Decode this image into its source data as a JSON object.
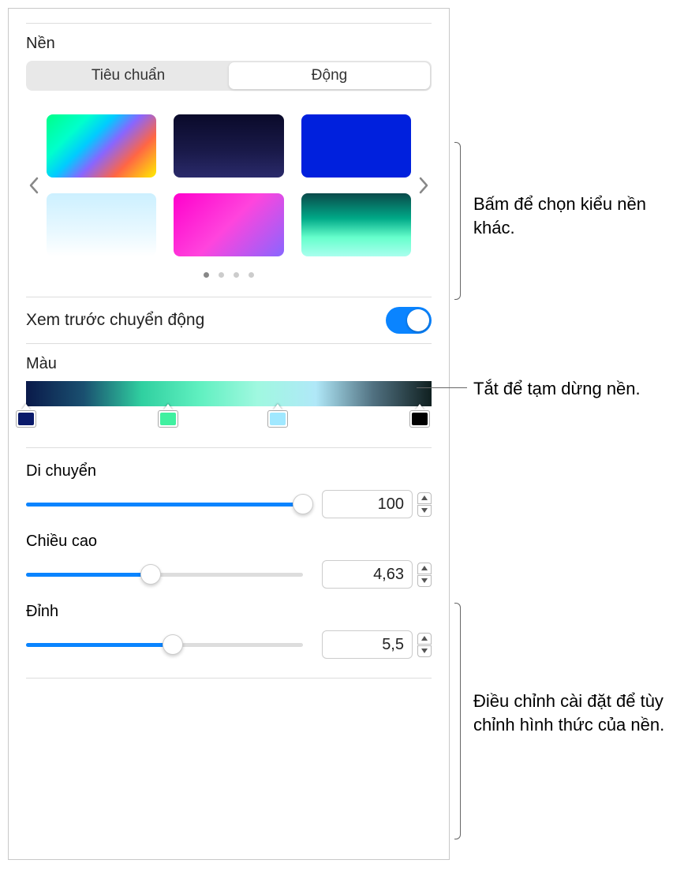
{
  "section_bg_title": "Nền",
  "segments": {
    "standard": "Tiêu chuẩn",
    "dynamic": "Động"
  },
  "thumbs": [
    {
      "name": "rainbow-gradient",
      "style": "background:linear-gradient(135deg,#00ff88 0%,#00ffcc 25%,#00ccff 40%,#8866ff 55%,#ff6644 75%,#ffee00 100%)"
    },
    {
      "name": "dark-clouds",
      "style": "background:linear-gradient(180deg,#0a0a2a 0%,#1a1a4a 60%,#2a2a6a 100%)"
    },
    {
      "name": "solid-blue",
      "style": "background:#0020dd"
    },
    {
      "name": "white-cloud-sky",
      "style": "background:linear-gradient(180deg,#ccf0ff 0%,#e8f8ff 60%,#ffffff 100%)"
    },
    {
      "name": "magenta-blue",
      "style": "background:linear-gradient(135deg,#ff00cc 0%,#ff44dd 50%,#8866ff 100%)"
    },
    {
      "name": "teal-clouds",
      "style": "background:linear-gradient(180deg,#0a4a4a 0%,#00aa88 40%,#66ffcc 70%,#aaffee 100%)"
    }
  ],
  "motion_preview_label": "Xem trước chuyển động",
  "color_title": "Màu",
  "color_stops": [
    {
      "pos": 0,
      "color": "#0a1a6a"
    },
    {
      "pos": 35,
      "color": "#40f0a0"
    },
    {
      "pos": 62,
      "color": "#a0e8ff"
    },
    {
      "pos": 97,
      "color": "#000000"
    }
  ],
  "sliders": {
    "move": {
      "label": "Di chuyển",
      "value": "100",
      "percent": 100
    },
    "height": {
      "label": "Chiều cao",
      "value": "4,63",
      "percent": 45
    },
    "peak": {
      "label": "Đỉnh",
      "value": "5,5",
      "percent": 53
    }
  },
  "callouts": {
    "pick_style": "Bấm để chọn kiểu nền khác.",
    "toggle_off": "Tắt để tạm dừng nền.",
    "adjust": "Điều chỉnh cài đặt để tùy chỉnh hình thức của nền."
  }
}
